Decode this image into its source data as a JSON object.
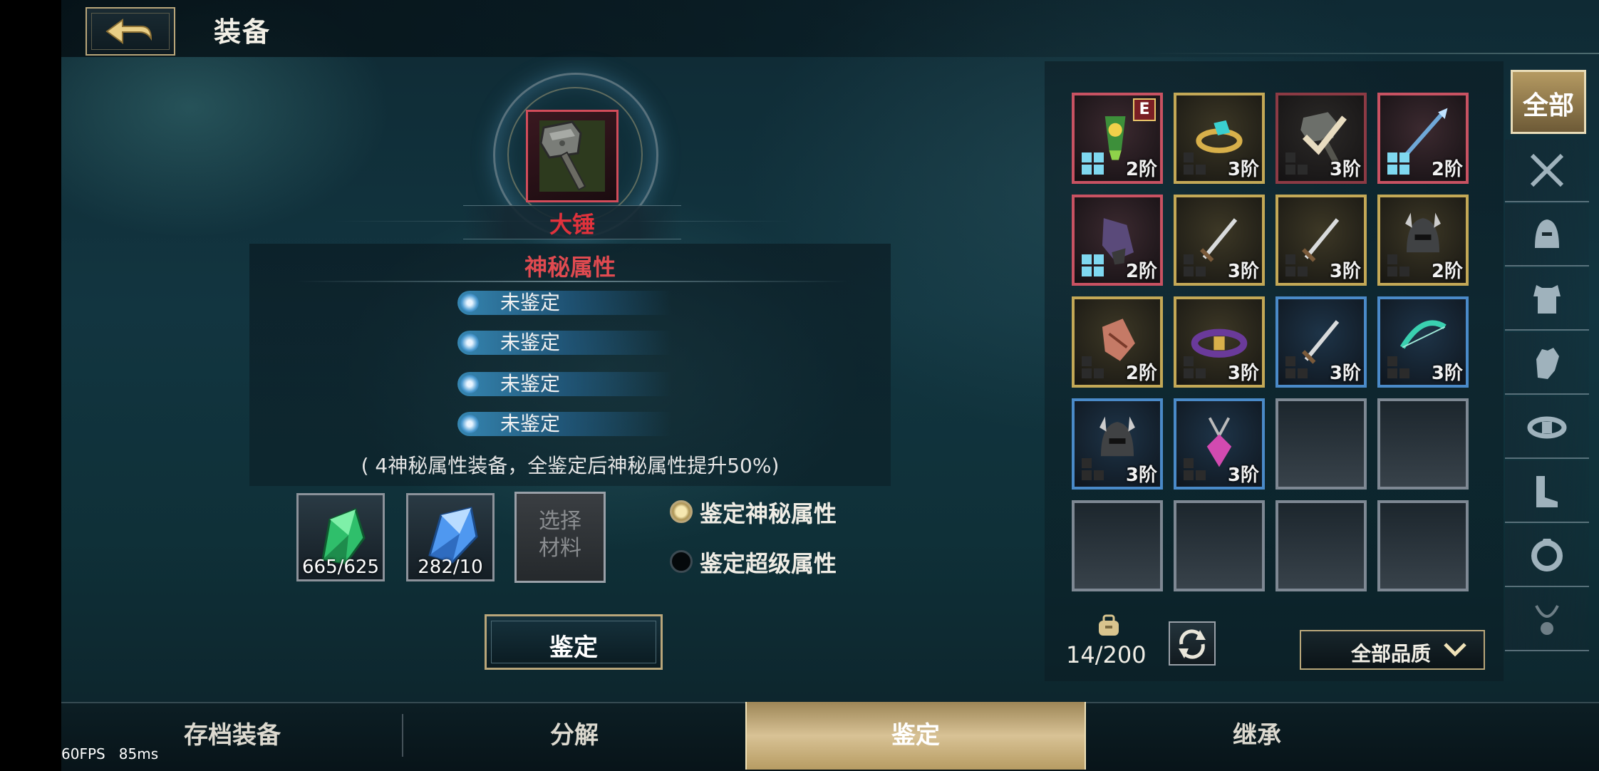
{
  "header": {
    "title": "装备"
  },
  "weapon": {
    "name": "大锤",
    "icon": "hammer-icon"
  },
  "attributes": {
    "title": "神秘属性",
    "rows": [
      "未鉴定",
      "未鉴定",
      "未鉴定",
      "未鉴定"
    ],
    "note": "( 4神秘属性装备，全鉴定后神秘属性提升50%)"
  },
  "materials": [
    {
      "name": "green-crystal",
      "count": "665/625",
      "color": "#3fd27a"
    },
    {
      "name": "blue-crystal",
      "count": "282/10",
      "color": "#5aa6ff"
    }
  ],
  "select_material": {
    "line1": "选择",
    "line2": "材料"
  },
  "options": [
    {
      "label": "鉴定神秘属性",
      "selected": true
    },
    {
      "label": "鉴定超级属性",
      "selected": false
    }
  ],
  "identify_button": "鉴定",
  "inventory": {
    "items": [
      {
        "icon": "amulet-icon",
        "quality": "red",
        "tier": "2阶",
        "badge": "E"
      },
      {
        "icon": "ring-icon",
        "quality": "gold",
        "tier": "3阶",
        "badge": ""
      },
      {
        "icon": "hammer-icon",
        "quality": "equipped",
        "tier": "3阶",
        "badge": ""
      },
      {
        "icon": "spear-icon",
        "quality": "red",
        "tier": "2阶",
        "badge": ""
      },
      {
        "icon": "gauntlet-icon",
        "quality": "red",
        "tier": "2阶",
        "badge": ""
      },
      {
        "icon": "dagger-icon",
        "quality": "gold",
        "tier": "3阶",
        "badge": ""
      },
      {
        "icon": "dagger-icon",
        "quality": "gold",
        "tier": "3阶",
        "badge": ""
      },
      {
        "icon": "helmet-icon",
        "quality": "gold",
        "tier": "2阶",
        "badge": ""
      },
      {
        "icon": "glove-icon",
        "quality": "gold",
        "tier": "2阶",
        "badge": ""
      },
      {
        "icon": "belt-icon",
        "quality": "gold",
        "tier": "3阶",
        "badge": ""
      },
      {
        "icon": "dagger-icon",
        "quality": "blue",
        "tier": "3阶",
        "badge": ""
      },
      {
        "icon": "bow-icon",
        "quality": "blue",
        "tier": "3阶",
        "badge": ""
      },
      {
        "icon": "helmet-icon",
        "quality": "blue",
        "tier": "3阶",
        "badge": ""
      },
      {
        "icon": "pendant-icon",
        "quality": "blue",
        "tier": "3阶",
        "badge": ""
      }
    ],
    "bag_count": "14/200"
  },
  "categories": {
    "all_label": "全部",
    "icons": [
      "crossed-swords-icon",
      "helmet-icon",
      "armor-icon",
      "glove-icon",
      "belt-icon",
      "boots-icon",
      "ring-icon",
      "amulet-icon"
    ]
  },
  "filter": {
    "label": "全部品质"
  },
  "bottom_tabs": [
    {
      "label": "存档装备",
      "active": false
    },
    {
      "label": "分解",
      "active": false
    },
    {
      "label": "鉴定",
      "active": true
    },
    {
      "label": "继承",
      "active": false
    }
  ],
  "debug": {
    "fps": "60FPS",
    "latency": "85ms"
  },
  "colors": {
    "accent_gold": "#b9a67a",
    "red_name": "#e0323c",
    "quality_red": "#c85262",
    "quality_gold": "#c3a856",
    "quality_blue": "#4a8ac8"
  }
}
